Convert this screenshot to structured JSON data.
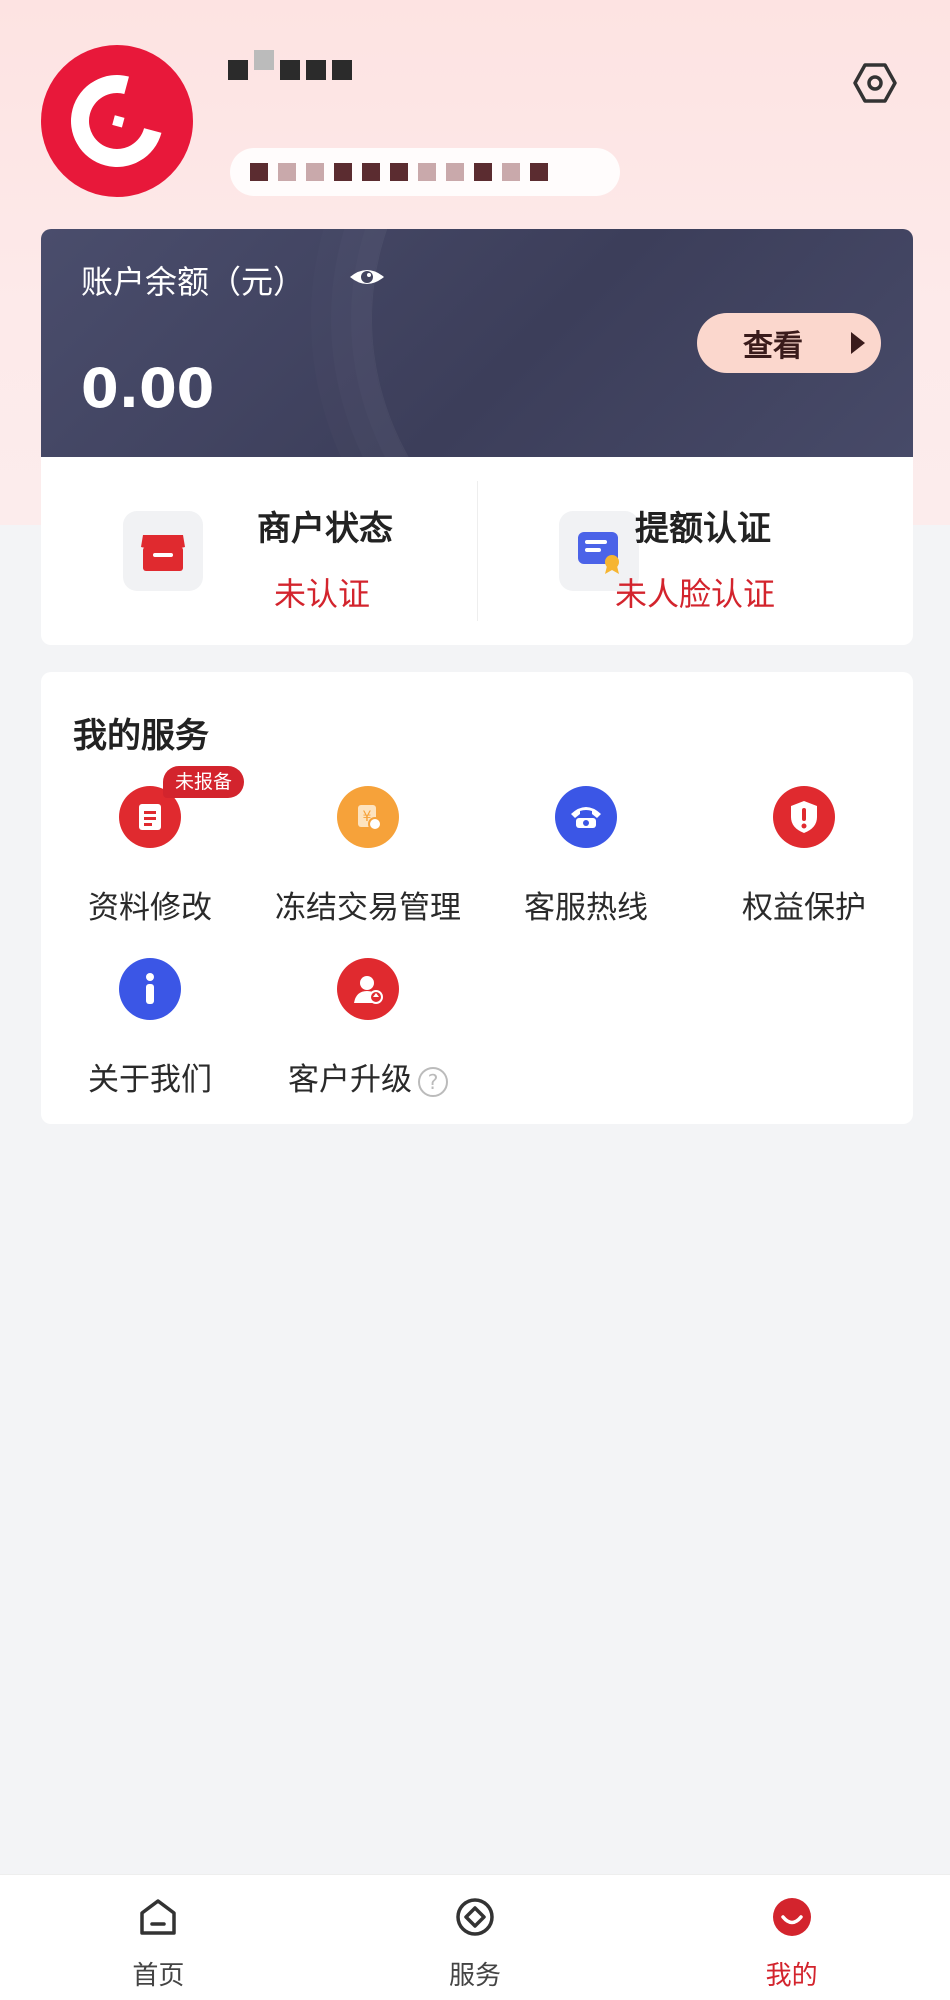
{
  "colors": {
    "accent_red": "#d3242d",
    "card_dark": "#43455f",
    "view_button_bg": "#fbd7cd",
    "page_bg": "#f3f4f6"
  },
  "header": {
    "avatar_icon": "brand-logo-icon",
    "settings_icon": "settings-hex-icon"
  },
  "balance": {
    "label": "账户余额（元）",
    "amount": "0.00",
    "view_label": "查看"
  },
  "status": {
    "merchant_title": "商户状态",
    "merchant_value": "未认证",
    "limit_title": "提额认证",
    "limit_value": "未人脸认证"
  },
  "services": {
    "title": "我的服务",
    "items": [
      {
        "label": "资料修改",
        "badge": "未报备",
        "icon": "document-edit-icon",
        "color": "#e02a2f"
      },
      {
        "label": "冻结交易管理",
        "icon": "frozen-yuan-icon",
        "color": "#f6a23a"
      },
      {
        "label": "客服热线",
        "icon": "phone-icon",
        "color": "#3b56e6"
      },
      {
        "label": "权益保护",
        "icon": "shield-alert-icon",
        "color": "#e02a2f"
      },
      {
        "label": "关于我们",
        "icon": "info-icon",
        "color": "#3b56e6"
      },
      {
        "label": "客户升级",
        "icon": "user-upgrade-icon",
        "color": "#e02a2f",
        "help": "?"
      }
    ]
  },
  "nav": {
    "home": "首页",
    "services": "服务",
    "mine": "我的",
    "active": "mine"
  }
}
